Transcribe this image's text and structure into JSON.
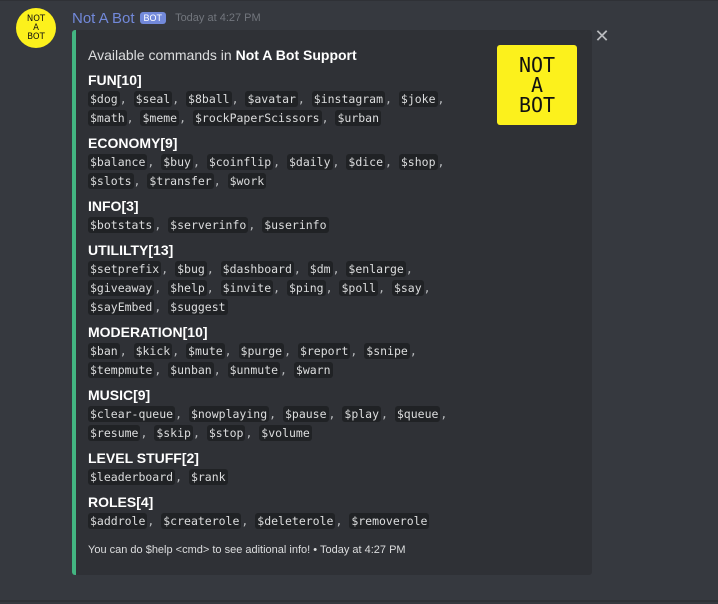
{
  "message": {
    "username": "Not A Bot",
    "bot_tag": "BOT",
    "timestamp": "Today at 4:27 PM",
    "avatar_text": [
      "NOT",
      "A",
      "BOT"
    ]
  },
  "embed": {
    "title_prefix": "Available commands in ",
    "title_bold": "Not A Bot Support",
    "thumbnail_text": [
      "NOT",
      "A",
      "BOT"
    ],
    "sections": [
      {
        "name": "FUN[10]",
        "commands": [
          "$dog",
          "$seal",
          "$8ball",
          "$avatar",
          "$instagram",
          "$joke",
          "$math",
          "$meme",
          "$rockPaperScissors",
          "$urban"
        ]
      },
      {
        "name": "ECONOMY[9]",
        "commands": [
          "$balance",
          "$buy",
          "$coinflip",
          "$daily",
          "$dice",
          "$shop",
          "$slots",
          "$transfer",
          "$work"
        ]
      },
      {
        "name": "INFO[3]",
        "commands": [
          "$botstats",
          "$serverinfo",
          "$userinfo"
        ]
      },
      {
        "name": "UTILILTY[13]",
        "commands": [
          "$setprefix",
          "$bug",
          "$dashboard",
          "$dm",
          "$enlarge",
          "$giveaway",
          "$help",
          "$invite",
          "$ping",
          "$poll",
          "$say",
          "$sayEmbed",
          "$suggest"
        ]
      },
      {
        "name": "MODERATION[10]",
        "commands": [
          "$ban",
          "$kick",
          "$mute",
          "$purge",
          "$report",
          "$snipe",
          "$tempmute",
          "$unban",
          "$unmute",
          "$warn"
        ]
      },
      {
        "name": "MUSIC[9]",
        "commands": [
          "$clear-queue",
          "$nowplaying",
          "$pause",
          "$play",
          "$queue",
          "$resume",
          "$skip",
          "$stop",
          "$volume"
        ]
      },
      {
        "name": "LEVEL STUFF[2]",
        "commands": [
          "$leaderboard",
          "$rank"
        ]
      },
      {
        "name": "ROLES[4]",
        "commands": [
          "$addrole",
          "$createrole",
          "$deleterole",
          "$removerole"
        ]
      }
    ],
    "footer_text": "You can do $help <cmd> to see aditional info!",
    "footer_separator": " • ",
    "footer_timestamp": "Today at 4:27 PM",
    "close_symbol": "✕"
  },
  "icons": {
    "close": "close-icon"
  },
  "colors": {
    "background": "#36393f",
    "embed_background": "#2f3136",
    "embed_accent": "#43b581",
    "username": "#7289da",
    "bot_tag": "#7289da",
    "logo_yellow": "#fcf11c",
    "code_background": "#202225"
  }
}
